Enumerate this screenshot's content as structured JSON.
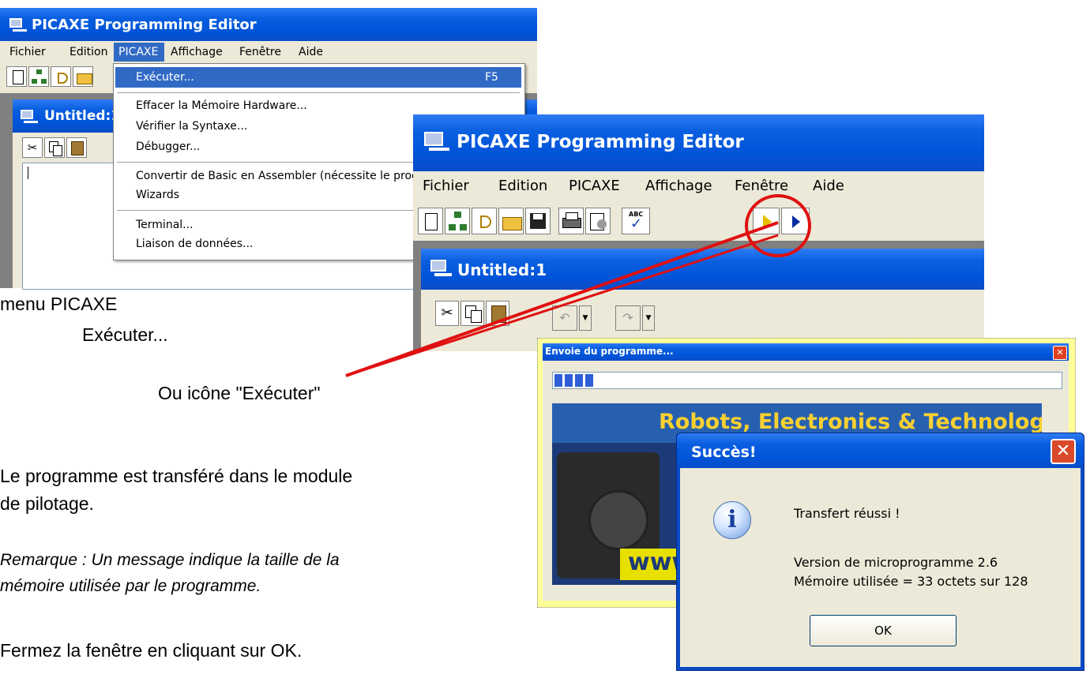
{
  "back_window": {
    "title": "PICAXE Programming Editor",
    "menu": [
      "Fichier",
      "Edition",
      "PICAXE",
      "Affichage",
      "Fenêtre",
      "Aide"
    ],
    "child_title": "Untitled:1"
  },
  "dropdown": {
    "items": [
      {
        "label": "Exécuter...",
        "shortcut": "F5"
      },
      {
        "label": "Effacer la Mémoire Hardware..."
      },
      {
        "label": "Vérifier la Syntaxe..."
      },
      {
        "label": "Débugger..."
      },
      {
        "label": "Convertir de Basic en Assembler (nécessite le prog"
      },
      {
        "label": "Wizards"
      },
      {
        "label": "Terminal..."
      },
      {
        "label": "Liaison de données..."
      }
    ]
  },
  "front_window": {
    "title": "PICAXE Programming Editor",
    "menu": [
      "Fichier",
      "Edition",
      "PICAXE",
      "Affichage",
      "Fenêtre",
      "Aide"
    ],
    "child_title": "Untitled:1",
    "spell_icon_text": "ABC"
  },
  "progress_dialog": {
    "title": "Envoie du programme...",
    "progress": 0.08,
    "banner_text": "Robots, Electronics & Technology",
    "banner_url": "www.t"
  },
  "success_dialog": {
    "title": "Succès!",
    "line1": "Transfert réussi !",
    "line2": "Version de microprogramme 2.6",
    "line3": "Mémoire utilisée = 33 octets sur 128",
    "ok_label": "OK"
  },
  "annotations": {
    "menu_label": "menu PICAXE",
    "menu_item": "Exécuter...",
    "icon_hint": "Ou icône \"Exécuter\"",
    "para1_line1": "Le programme est transféré dans le module",
    "para1_line2": "de pilotage.",
    "remark_line1": "Remarque : Un message indique la taille de la",
    "remark_line2": "mémoire utilisée par le programme.",
    "close_hint": "Fermez la fenêtre en cliquant sur OK."
  },
  "colors": {
    "xp_blue": "#0054d8",
    "menu_highlight": "#316ac5",
    "annotation_red": "#e01010",
    "dialog_frame_yellow": "#ffff99"
  }
}
